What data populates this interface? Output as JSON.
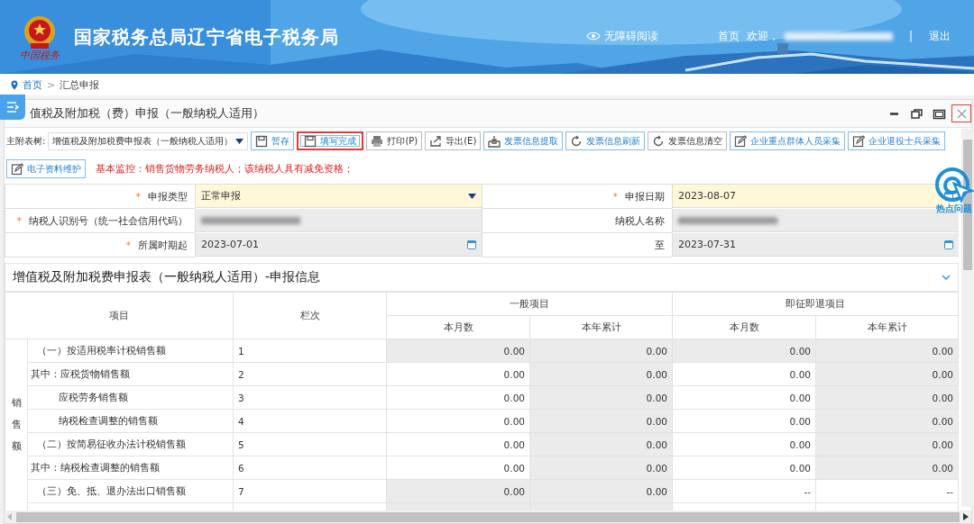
{
  "header": {
    "logo_text": "中国税务",
    "title": "国家税务总局辽宁省电子税务局",
    "accessibility": "无障碍阅读",
    "home": "首页",
    "welcome": "欢迎，",
    "separator": "|",
    "logout": "退出"
  },
  "breadcrumb": {
    "separator": ">",
    "items": [
      {
        "label": "首页",
        "link": true
      },
      {
        "label": "汇总申报",
        "link": false
      }
    ]
  },
  "panel": {
    "title": "值税及附加税（费）申报（一般纳税人适用）",
    "controls": [
      {
        "kind": "minimize",
        "highlighted": false
      },
      {
        "kind": "restore",
        "highlighted": false
      },
      {
        "kind": "maximize",
        "highlighted": false
      },
      {
        "kind": "close",
        "highlighted": true
      }
    ]
  },
  "toolbar": {
    "tree_label": "主附表树:",
    "tree_value": "增值税及附加税费申报表（一般纳税人适用）",
    "buttons": [
      {
        "label": "暂存",
        "kind": "save",
        "highlighted": false
      },
      {
        "label": "填写完成",
        "kind": "save",
        "highlighted": true
      },
      {
        "label": "打印(P)",
        "kind": "print",
        "highlighted": false
      },
      {
        "label": "导出(E)",
        "kind": "export",
        "highlighted": false
      },
      {
        "label": "发票信息提取",
        "kind": "fetch",
        "highlighted": false
      },
      {
        "label": "发票信息刷新",
        "kind": "refresh",
        "highlighted": false
      },
      {
        "label": "发票信息清空",
        "kind": "clear",
        "highlighted": false
      },
      {
        "label": "企业重点群体人员采集",
        "kind": "edit",
        "highlighted": false
      },
      {
        "label": "企业退役士兵采集",
        "kind": "edit",
        "highlighted": false
      },
      {
        "label": "电子资料维护",
        "kind": "edit",
        "highlighted": false
      }
    ],
    "notice": "基本监控：销售货物劳务纳税人；该纳税人具有减免资格；"
  },
  "hot_topics": {
    "label": "热点问题"
  },
  "form": {
    "rows": [
      [
        {
          "label": "申报类型",
          "marker": "*",
          "value": "正常申报",
          "kind": "select",
          "editable": true
        },
        {
          "label": "申报日期",
          "marker": "*",
          "value": "2023-08-07",
          "kind": "date",
          "editable": true
        }
      ],
      [
        {
          "label": "纳税人识别号（统一社会信用代码）",
          "marker": "*",
          "kind": "blurred",
          "editable": false
        },
        {
          "label": "纳税人名称",
          "kind": "blurred",
          "editable": false
        }
      ],
      [
        {
          "label": "所属时期起",
          "marker": "*",
          "value": "2023-07-01",
          "kind": "date",
          "editable": false
        },
        {
          "label": "至",
          "value": "2023-07-31",
          "kind": "date",
          "editable": false
        }
      ]
    ]
  },
  "section": {
    "title": "增值税及附加税费申报表（一般纳税人适用）-申报信息",
    "expanded": true
  },
  "table": {
    "item_header": "项目",
    "line_header": "栏次",
    "groups": [
      {
        "label": "一般项目",
        "columns": [
          "本月数",
          "本年累计"
        ]
      },
      {
        "label": "即征即退项目",
        "columns": [
          "本月数",
          "本年累计"
        ]
      }
    ],
    "row_group": "销售额",
    "rows": [
      {
        "item": "（一）按适用税率计税销售额",
        "kind": "heading",
        "line": "1",
        "cells": [
          {
            "value": "0.00",
            "editable": false
          },
          {
            "value": "0.00",
            "editable": false
          },
          {
            "value": "0.00",
            "editable": false
          },
          {
            "value": "0.00",
            "editable": false
          }
        ]
      },
      {
        "item": "其中：应税货物销售额",
        "kind": "sub",
        "line": "2",
        "cells": [
          {
            "value": "0.00",
            "editable": true
          },
          {
            "value": "0.00",
            "editable": false
          },
          {
            "value": "0.00",
            "editable": true
          },
          {
            "value": "0.00",
            "editable": false
          }
        ]
      },
      {
        "item": "应税劳务销售额",
        "kind": "continuation",
        "line": "3",
        "cells": [
          {
            "value": "0.00",
            "editable": true
          },
          {
            "value": "0.00",
            "editable": false
          },
          {
            "value": "0.00",
            "editable": true
          },
          {
            "value": "0.00",
            "editable": false
          }
        ]
      },
      {
        "item": "纳税检查调整的销售额",
        "kind": "continuation",
        "line": "4",
        "cells": [
          {
            "value": "0.00",
            "editable": true
          },
          {
            "value": "0.00",
            "editable": false
          },
          {
            "value": "0.00",
            "editable": true
          },
          {
            "value": "0.00",
            "editable": false
          }
        ]
      },
      {
        "item": "（二）按简易征收办法计税销售额",
        "kind": "heading",
        "line": "5",
        "cells": [
          {
            "value": "0.00",
            "editable": true
          },
          {
            "value": "0.00",
            "editable": false
          },
          {
            "value": "0.00",
            "editable": true
          },
          {
            "value": "0.00",
            "editable": false
          }
        ]
      },
      {
        "item": "其中：纳税检查调整的销售额",
        "kind": "sub",
        "line": "6",
        "cells": [
          {
            "value": "0.00",
            "editable": true
          },
          {
            "value": "0.00",
            "editable": false
          },
          {
            "value": "0.00",
            "editable": true
          },
          {
            "value": "0.00",
            "editable": false
          }
        ]
      },
      {
        "item": "（三）免、抵、退办法出口销售额",
        "kind": "heading",
        "line": "7",
        "cells": [
          {
            "value": "0.00",
            "editable": false
          },
          {
            "value": "0.00",
            "editable": false
          },
          {
            "value": "--",
            "editable": true
          },
          {
            "value": "--",
            "editable": true
          }
        ]
      }
    ]
  }
}
